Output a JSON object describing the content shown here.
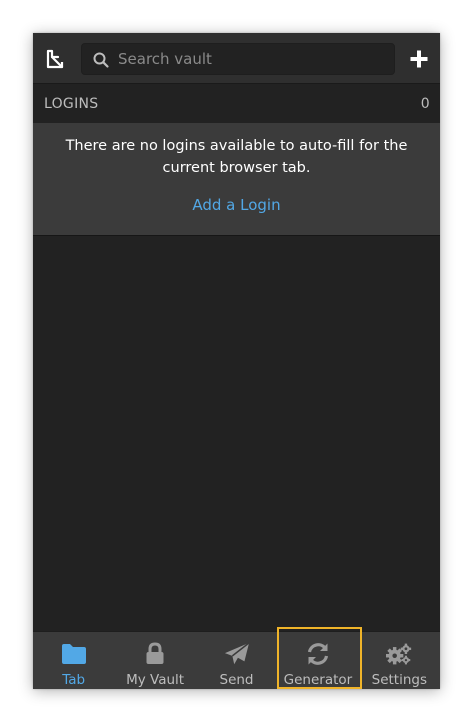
{
  "header": {
    "search_placeholder": "Search vault"
  },
  "logins": {
    "section_label": "LOGINS",
    "count": "0",
    "empty_message": "There are no logins available to auto-fill for the current browser tab.",
    "add_label": "Add a Login"
  },
  "tabs": [
    {
      "label": "Tab",
      "icon": "folder-icon",
      "active": true
    },
    {
      "label": "My Vault",
      "icon": "lock-icon",
      "active": false
    },
    {
      "label": "Send",
      "icon": "send-icon",
      "active": false
    },
    {
      "label": "Generator",
      "icon": "refresh-icon",
      "active": false
    },
    {
      "label": "Settings",
      "icon": "cogs-icon",
      "active": false
    }
  ],
  "colors": {
    "accent": "#52a8e6",
    "highlight": "#f0b429",
    "background": "#222222",
    "panel": "#3b3b3b"
  }
}
